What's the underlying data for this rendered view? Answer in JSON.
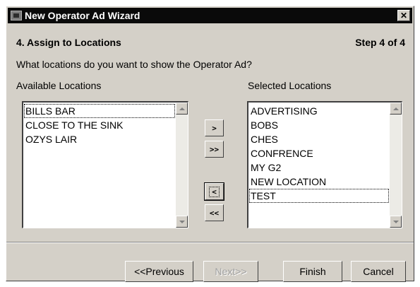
{
  "window": {
    "title": "New Operator Ad Wizard",
    "close_glyph": "✕"
  },
  "step": {
    "title": "4. Assign to Locations",
    "count": "Step 4 of 4",
    "question": "What locations do you want to show the Operator Ad?"
  },
  "available": {
    "label": "Available Locations",
    "items": [
      "BILLS BAR",
      "CLOSE TO THE SINK",
      "OZYS LAIR"
    ],
    "focused_index": 0
  },
  "selected": {
    "label": "Selected Locations",
    "items": [
      "ADVERTISING",
      "BOBS",
      "CHES",
      "CONFRENCE",
      "MY G2",
      "NEW LOCATION",
      "TEST"
    ],
    "focused_index": 6
  },
  "transfer_buttons": {
    "add": ">",
    "add_all": ">>",
    "remove": "<",
    "remove_all": "<<"
  },
  "nav": {
    "previous": "<<Previous",
    "next": "Next>>",
    "finish": "Finish",
    "cancel": "Cancel",
    "next_enabled": false
  },
  "icons": {
    "app": "wizard-app-icon",
    "close": "close-icon",
    "scroll_up": "scroll-up-arrow-icon",
    "scroll_down": "scroll-down-arrow-icon"
  },
  "colors": {
    "window_bg": "#d4d0c8",
    "titlebar_bg": "#0a0a0a",
    "disabled_text": "#a0a0a0"
  }
}
